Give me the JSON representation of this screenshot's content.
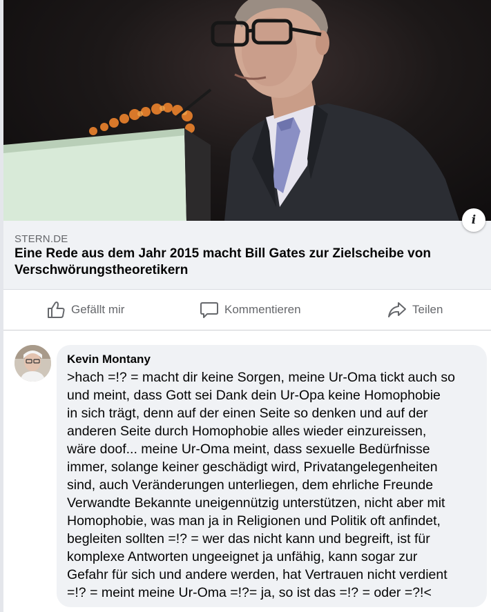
{
  "link_preview": {
    "domain": "STERN.DE",
    "title": "Eine Rede aus dem Jahr 2015 macht Bill Gates zur Zielscheibe von Verschwörungstheoretikern",
    "image_icon": "speaker-at-podium-photo",
    "info_icon": "info-icon"
  },
  "actions": {
    "like_label": "Gefällt mir",
    "comment_label": "Kommentieren",
    "share_label": "Teilen",
    "like_icon": "thumbs-up-icon",
    "comment_icon": "speech-bubble-icon",
    "share_icon": "share-arrow-icon"
  },
  "comment": {
    "author": "Kevin Montany",
    "text": ">hach =!? = macht dir keine Sorgen, meine Ur-Oma tickt auch so\nund meint, dass Gott sei Dank dein Ur-Opa keine Homophobie\nin sich trägt, denn auf der einen Seite so denken und auf der\nanderen Seite durch Homophobie alles wieder einzureissen,\nwäre doof... meine Ur-Oma meint, dass sexuelle Bedürfnisse\nimmer, solange keiner geschädigt wird, Privatangelegenheiten\nsind, auch Veränderungen unterliegen, dem ehrliche Freunde\nVerwandte Bekannte uneigennützig unterstützen, nicht aber mit\nHomophobie, was man ja in Religionen und Politik oft anfindet,\nbegleiten sollten =!? = wer das nicht kann und begreift, ist für\nkomplexe Antworten ungeeignet ja unfähig, kann sogar zur\nGefahr für sich und andere werden, hat Vertrauen nicht verdient\n=!? = meint meine Ur-Oma =!?= ja, so ist das =!? = oder =?!<"
  },
  "colors": {
    "secondary_text": "#65676b",
    "bubble_bg": "#f0f2f5",
    "caption_bg": "#f0f2f5"
  }
}
